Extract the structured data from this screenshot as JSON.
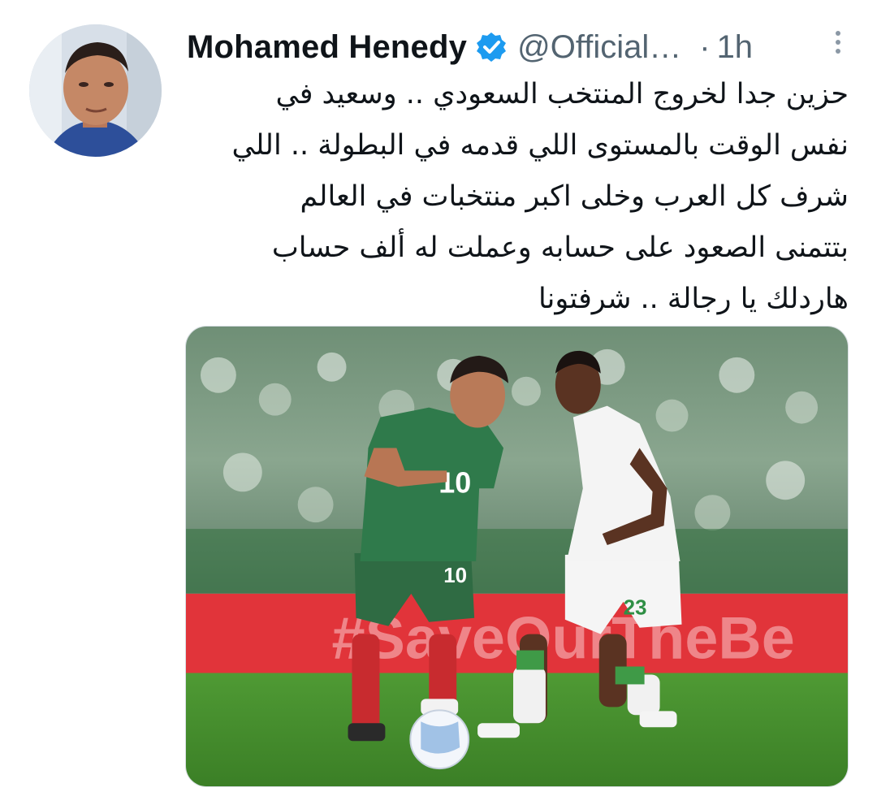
{
  "author": {
    "display_name": "Mohamed Henedy",
    "handle": "@Official…",
    "verified_badge_icon": "verified-check-icon",
    "verified_color": "#1d9bf0"
  },
  "meta": {
    "separator": "·",
    "time": "1h",
    "more_icon": "more-vertical-icon"
  },
  "tweet": {
    "lines": [
      "حزين جدا لخروج المنتخب السعودي .. وسعيد في",
      "نفس الوقت بالمستوى اللي قدمه في البطولة .. اللي",
      "شرف كل العرب وخلى اكبر منتخبات في العالم",
      "بتتمنى الصعود على حسابه وعملت له ألف حساب",
      "هاردلك يا رجالة .. شرفتونا"
    ]
  },
  "media": {
    "kind": "photo",
    "left_player_number": "10",
    "right_player_number": "23",
    "board_text": "#SaveOurTheBe"
  },
  "colors": {
    "text_primary": "#0f1419",
    "text_secondary": "#536471",
    "pitch_green": "#3f8a2c",
    "board_red": "#e1343a"
  }
}
